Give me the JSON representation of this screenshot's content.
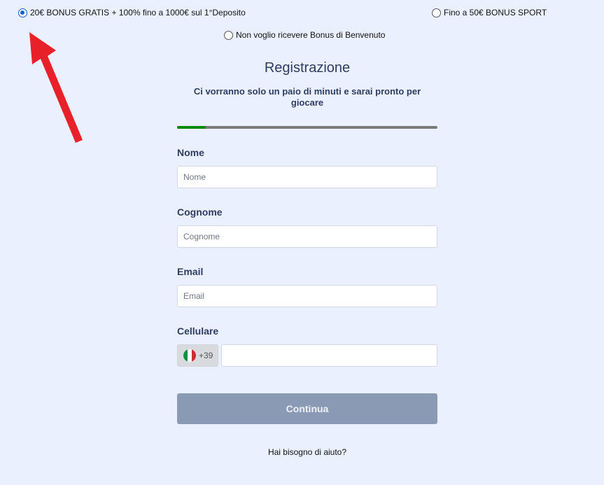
{
  "bonus_options": [
    {
      "label": "20€ BONUS GRATIS + 100% fino a 1000€ sul 1°Deposito",
      "checked": true
    },
    {
      "label": "Fino a 50€ BONUS SPORT",
      "checked": false
    },
    {
      "label": "Non voglio ricevere Bonus di Benvenuto",
      "checked": false
    }
  ],
  "form": {
    "title": "Registrazione",
    "subtitle": "Ci vorranno solo un paio di minuti e sarai pronto per giocare",
    "progress_percent": 11,
    "fields": {
      "nome": {
        "label": "Nome",
        "placeholder": "Nome",
        "value": ""
      },
      "cognome": {
        "label": "Cognome",
        "placeholder": "Cognome",
        "value": ""
      },
      "email": {
        "label": "Email",
        "placeholder": "Email",
        "value": ""
      },
      "cellulare": {
        "label": "Cellulare",
        "prefix": "+39",
        "placeholder": "",
        "value": ""
      }
    },
    "submit_label": "Continua",
    "help_link": "Hai bisogno di aiuto?"
  },
  "colors": {
    "background": "#eaf0fd",
    "heading": "#2e3d5f",
    "progress_fill": "#0a8a0a",
    "button": "#8a9ab4",
    "arrow": "#e8202a"
  },
  "icons": {
    "arrow": "red-arrow-icon",
    "flag": "italy-flag-icon"
  }
}
